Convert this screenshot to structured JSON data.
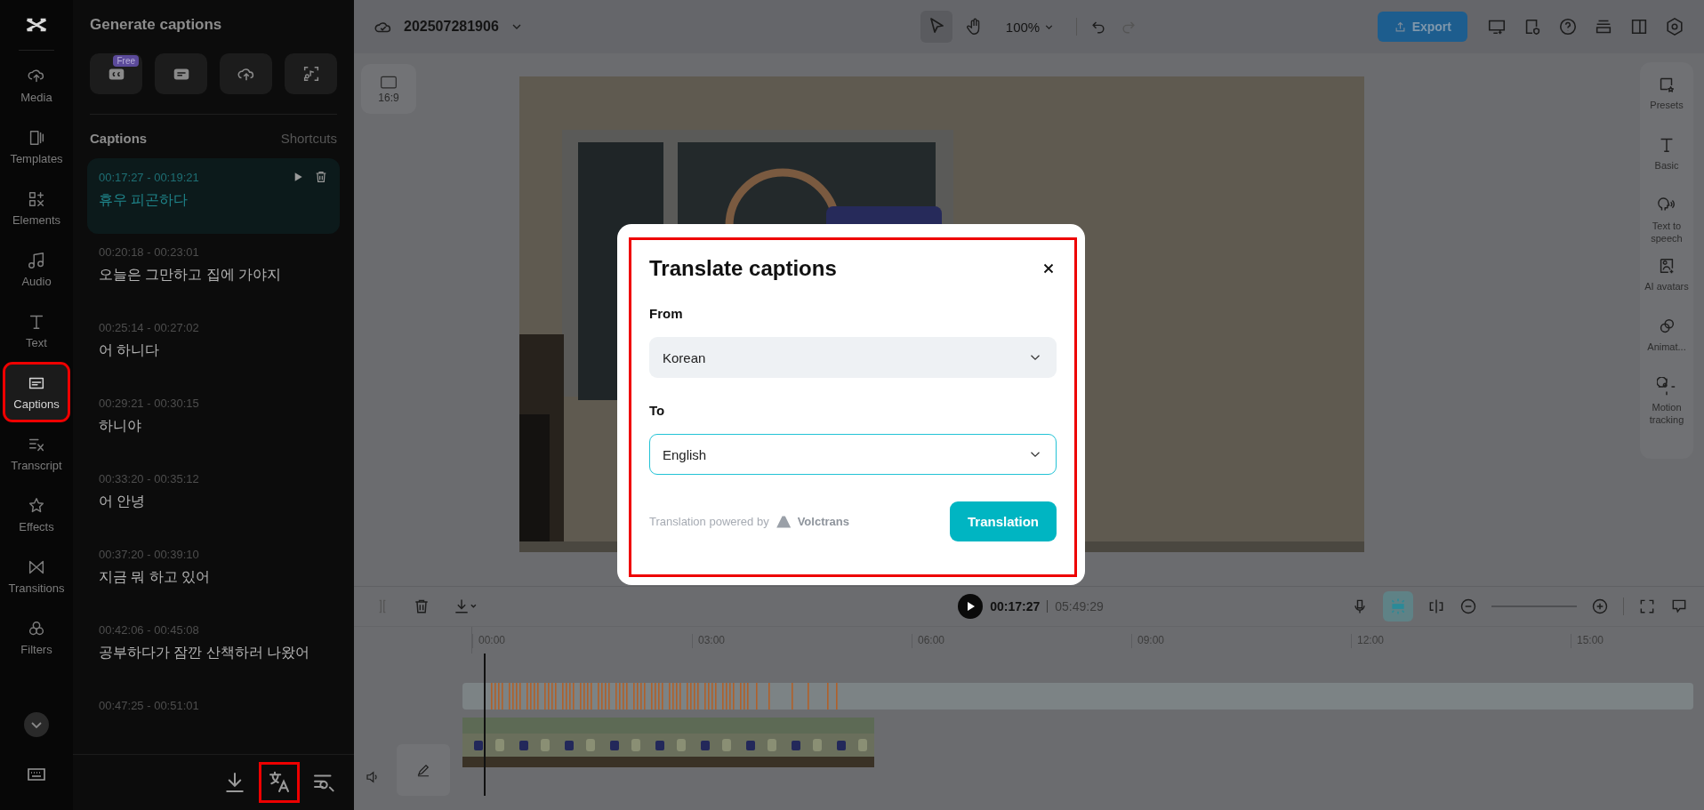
{
  "rail": {
    "items": [
      {
        "label": "Media",
        "selected": false,
        "highlighted": false
      },
      {
        "label": "Templates",
        "selected": false,
        "highlighted": false
      },
      {
        "label": "Elements",
        "selected": false,
        "highlighted": false
      },
      {
        "label": "Audio",
        "selected": false,
        "highlighted": false
      },
      {
        "label": "Text",
        "selected": false,
        "highlighted": false
      },
      {
        "label": "Captions",
        "selected": true,
        "highlighted": true
      },
      {
        "label": "Transcript",
        "selected": false,
        "highlighted": false
      },
      {
        "label": "Effects",
        "selected": false,
        "highlighted": false
      },
      {
        "label": "Transitions",
        "selected": false,
        "highlighted": false
      },
      {
        "label": "Filters",
        "selected": false,
        "highlighted": false
      }
    ]
  },
  "captions_panel": {
    "title": "Generate captions",
    "free_badge": "Free",
    "section_title": "Captions",
    "shortcuts": "Shortcuts",
    "items": [
      {
        "time": "00:17:27 - 00:19:21",
        "text": "휴우 피곤하다",
        "selected": true
      },
      {
        "time": "00:20:18 - 00:23:01",
        "text": "오늘은 그만하고 집에 가야지",
        "selected": false
      },
      {
        "time": "00:25:14 - 00:27:02",
        "text": "어 하니다",
        "selected": false
      },
      {
        "time": "00:29:21 - 00:30:15",
        "text": "하니야",
        "selected": false
      },
      {
        "time": "00:33:20 - 00:35:12",
        "text": "어 안녕",
        "selected": false
      },
      {
        "time": "00:37:20 - 00:39:10",
        "text": "지금 뭐 하고 있어",
        "selected": false
      },
      {
        "time": "00:42:06 - 00:45:08",
        "text": "공부하다가 잠깐 산책하러 나왔어",
        "selected": false
      },
      {
        "time": "00:47:25 - 00:51:01",
        "selected": false
      }
    ],
    "tools": [
      {
        "highlighted": false
      },
      {
        "highlighted": true
      },
      {
        "highlighted": false
      }
    ]
  },
  "topbar": {
    "project": "202507281906",
    "zoom": "100%",
    "export": "Export"
  },
  "canvas": {
    "aspect": "16:9"
  },
  "right_panel": {
    "items": [
      {
        "label": "Presets"
      },
      {
        "label": "Basic"
      },
      {
        "label": "Text to speech"
      },
      {
        "label": "AI avatars"
      },
      {
        "label": "Animat..."
      },
      {
        "label": "Motion tracking"
      }
    ]
  },
  "dialog": {
    "title": "Translate captions",
    "highlighted": true,
    "from_label": "From",
    "from_value": "Korean",
    "to_label": "To",
    "to_value": "English",
    "to_focused": true,
    "footer": "Translation powered by",
    "brand": "Volctrans",
    "button": "Translation"
  },
  "timeline": {
    "current": "00:17:27",
    "total": "05:49:29",
    "snap_on": true,
    "ticks": [
      "00:00",
      "03:00",
      "06:00",
      "09:00",
      "12:00",
      "15:00"
    ]
  }
}
